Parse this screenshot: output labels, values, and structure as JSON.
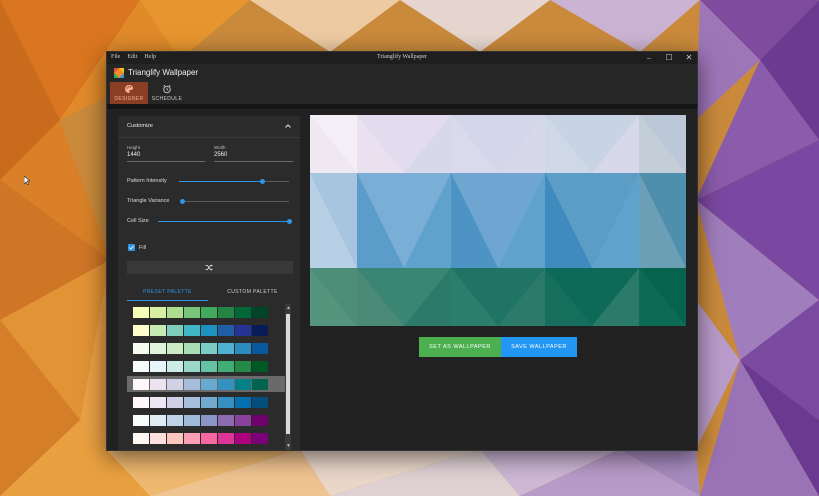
{
  "desktop": {
    "wallpaper_colors": {
      "warm": "#e3852b",
      "light": "#e9dcd3",
      "purple": "#8a5aa6"
    }
  },
  "window": {
    "menu": [
      "File",
      "Edit",
      "Help"
    ],
    "title": "Trianglify Wallpaper",
    "controls": {
      "minimize": "–",
      "maximize": "☐",
      "close": "✕"
    }
  },
  "app": {
    "name": "Trianglify Wallpaper",
    "tabs": [
      {
        "label": "DESIGNER",
        "icon": "palette-icon",
        "active": true
      },
      {
        "label": "SCHEDULE",
        "icon": "alarm-clock-icon",
        "active": false
      }
    ]
  },
  "customize": {
    "title": "Customize",
    "height": {
      "label": "Height",
      "value": "1440"
    },
    "width": {
      "label": "Width",
      "value": "2560"
    },
    "sliders": [
      {
        "label": "Pattern Intensity",
        "value": 0.76
      },
      {
        "label": "Triangle Variance",
        "value": 0.0
      },
      {
        "label": "Cell Size",
        "value": 1.0
      }
    ],
    "fill": {
      "label": "Fill",
      "checked": true
    },
    "shuffle_icon": "shuffle-icon",
    "palette_tabs": [
      {
        "label": "PRESET PALETTE",
        "active": true
      },
      {
        "label": "CUSTOM PALETTE",
        "active": false
      }
    ],
    "selected_palette_index": 4,
    "palettes": [
      [
        "#f7fcb9",
        "#d9f0a3",
        "#addd8e",
        "#78c679",
        "#41ab5d",
        "#238443",
        "#006837",
        "#004529"
      ],
      [
        "#ffffcc",
        "#c7e9b4",
        "#7fcdbb",
        "#41b6c4",
        "#1d91c0",
        "#225ea8",
        "#253494",
        "#081d58"
      ],
      [
        "#f7fcf0",
        "#e0f3db",
        "#ccebc5",
        "#a8ddb5",
        "#7bccc4",
        "#4eb3d3",
        "#2b8cbe",
        "#08589e"
      ],
      [
        "#f7fcfd",
        "#e5f5f9",
        "#ccece6",
        "#99d8c9",
        "#66c2a4",
        "#41ae76",
        "#238b45",
        "#005824"
      ],
      [
        "#fff7fb",
        "#ece2f0",
        "#d0d1e6",
        "#a6bddb",
        "#67a9cf",
        "#3690c0",
        "#02818a",
        "#016450"
      ],
      [
        "#fff7fb",
        "#ece7f2",
        "#d0d1e6",
        "#a6bddb",
        "#74a9cf",
        "#3690c0",
        "#0570b0",
        "#034e7b"
      ],
      [
        "#f7fcfd",
        "#e0ecf4",
        "#bfd3e6",
        "#9ebcda",
        "#8c96c6",
        "#8c6bb1",
        "#88419d",
        "#6e016b"
      ],
      [
        "#fff7f3",
        "#fde0dd",
        "#fcc5c0",
        "#fa9fb5",
        "#f768a1",
        "#dd3497",
        "#ae017e",
        "#7a0177"
      ]
    ]
  },
  "actions": {
    "set_wallpaper": "SET AS WALLPAPER",
    "save_wallpaper": "SAVE WALLPAPER"
  },
  "colors": {
    "accent": "#2f95e6",
    "set_button": "#4caf50",
    "save_button": "#2196f3",
    "active_tab": "#8a3e23"
  }
}
